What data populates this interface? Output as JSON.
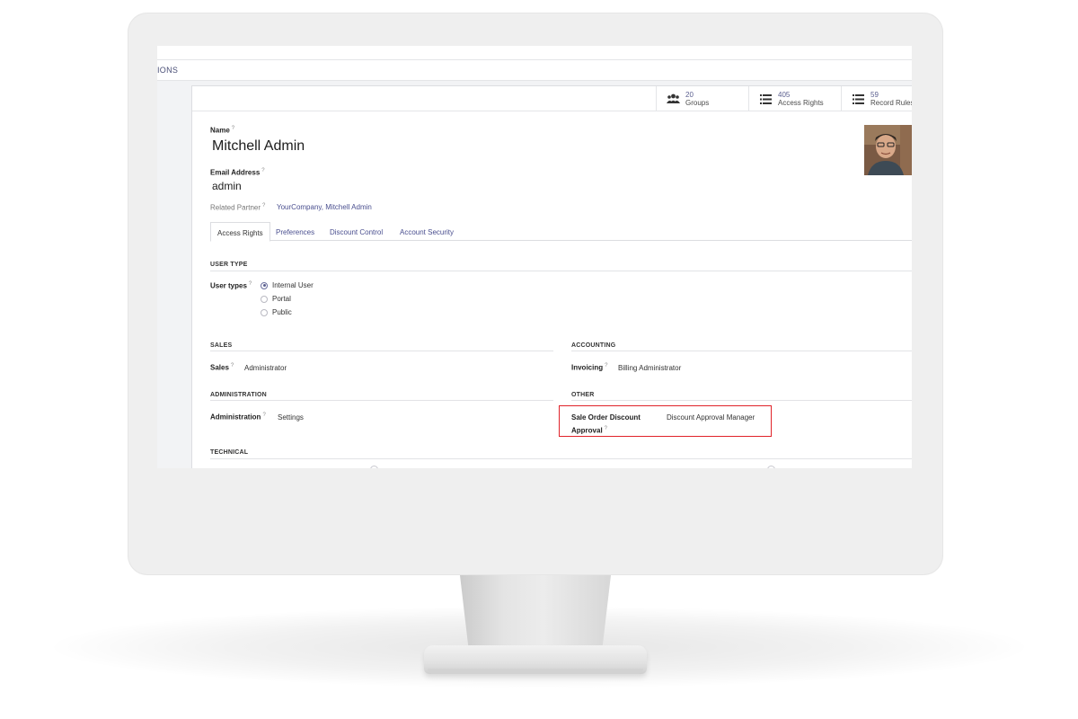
{
  "breadcrumb": "IONS",
  "stat_buttons": [
    {
      "value": "20",
      "label": "Groups",
      "icon": "users-icon"
    },
    {
      "value": "405",
      "label": "Access Rights",
      "icon": "list-icon"
    },
    {
      "value": "59",
      "label": "Record Rules",
      "icon": "list-icon"
    }
  ],
  "form": {
    "name_label": "Name",
    "name_value": "Mitchell Admin",
    "email_label": "Email Address",
    "email_value": "admin",
    "related_partner_label": "Related Partner",
    "related_partner_value": "YourCompany, Mitchell Admin",
    "help_mark": "?"
  },
  "tabs": [
    "Access Rights",
    "Preferences",
    "Discount Control",
    "Account Security"
  ],
  "user_type": {
    "section": "USER TYPE",
    "label": "User types",
    "options": [
      "Internal User",
      "Portal",
      "Public"
    ],
    "selected": "Internal User"
  },
  "sales": {
    "section": "SALES",
    "label": "Sales",
    "value": "Administrator"
  },
  "accounting": {
    "section": "ACCOUNTING",
    "label": "Invoicing",
    "value": "Billing Administrator"
  },
  "administration": {
    "section": "ADMINISTRATION",
    "label": "Administration",
    "value": "Settings"
  },
  "other": {
    "section": "OTHER",
    "label_line1": "Sale Order Discount",
    "label_line2": "Approval",
    "value": "Discount Approval Manager"
  },
  "technical": {
    "section": "TECHNICAL"
  },
  "colors": {
    "accent": "#5b5f8f",
    "highlight": "#e0232a"
  }
}
